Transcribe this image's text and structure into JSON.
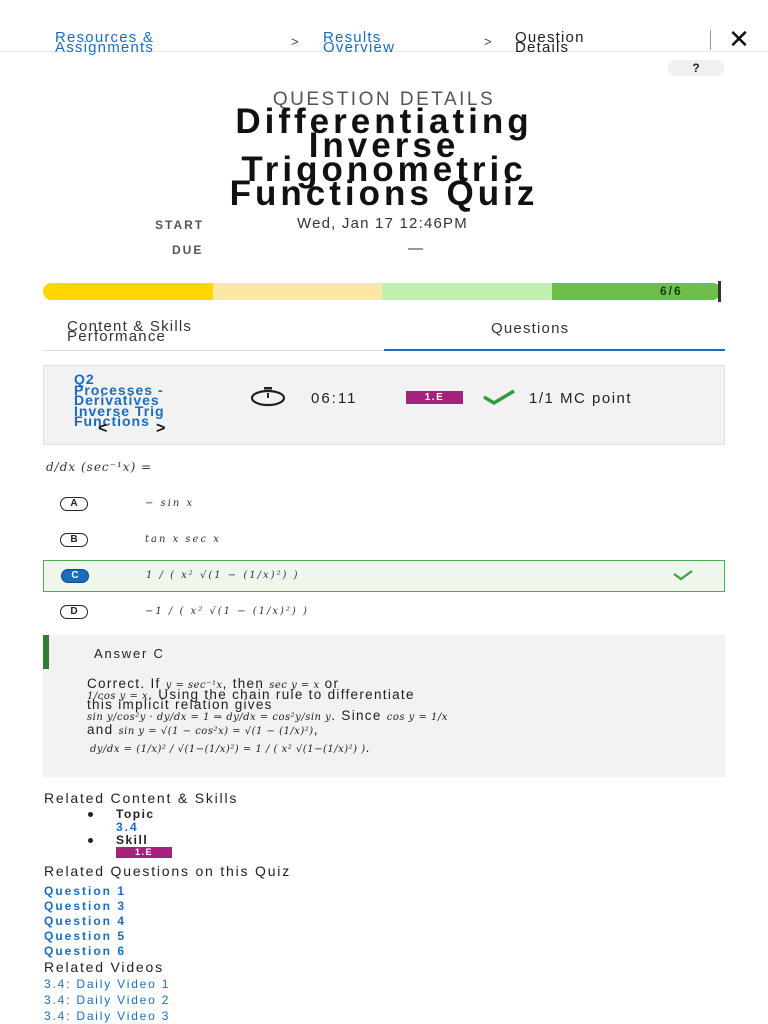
{
  "breadcrumb": {
    "item1_line1": "Resources &",
    "item1_line2": "Assignments",
    "item2_line1": "Results",
    "item2_line2": "Overview",
    "item3_line1": "Question",
    "item3_line2": "Details",
    "separator": ">"
  },
  "header": {
    "help_label": "?",
    "close_label": "✕",
    "eyebrow": "QUESTION DETAILS",
    "title_lines": [
      "Differentiating",
      "Inverse",
      "Trigonometric",
      "Functions Quiz"
    ],
    "start_label": "START",
    "start_value": "Wed, Jan 17 12:46PM",
    "due_label": "DUE",
    "due_value": "—"
  },
  "progress": {
    "label": "6/6",
    "segments": [
      "#ffd600",
      "#fbe9a3",
      "#c0f0ad",
      "#6cc04a"
    ]
  },
  "tabs": {
    "content_line1": "Content & Skills",
    "content_line2": "Performance",
    "questions": "Questions"
  },
  "question": {
    "link_lines": [
      "Q2",
      "Processes -",
      "Derivatives",
      "Inverse Trig",
      "Functions"
    ],
    "time": "06:11",
    "skill": "1.E",
    "score": "1/1 MC point",
    "prev": "<",
    "next": ">",
    "stem": "d/dx (sec⁻¹x) ="
  },
  "choices": [
    {
      "letter": "A",
      "text": "− sin x",
      "correct": false
    },
    {
      "letter": "B",
      "text": "tan x  sec x",
      "correct": false
    },
    {
      "letter": "C",
      "text": "1 / ( x² √(1 − (1/x)²) )",
      "correct": true
    },
    {
      "letter": "D",
      "text": "−1 / ( x² √(1 − (1/x)²) )",
      "correct": false
    }
  ],
  "answer": {
    "title": "Answer C",
    "line1a": "Correct. If ",
    "line1m1": "y = sec⁻¹x",
    "line1b": ", then ",
    "line1m2": "sec y = x",
    "line1c": " or",
    "line2m": "1/cos y = x",
    "line2b": ". Using the chain rule to differentiate",
    "line3": "this implicit relation gives",
    "line4m": "sin y/cos²y · dy/dx = 1 ⇒ dy/dx = cos²y/sin y",
    "line4b": ". Since ",
    "line4m2": "cos y = 1/x",
    "line5a": "and ",
    "line5m": "sin y = √(1 − cos²x) = √(1 − (1/x)²)",
    "line5b": ",",
    "line6m": "dy/dx = (1/x)² / √(1−(1/x)²) = 1 / ( x² √(1−(1/x)²) )",
    "line6b": "."
  },
  "related_content": {
    "heading": "Related Content & Skills",
    "topic_label": "Topic",
    "topic_value": "3.4",
    "skill_label": "Skill",
    "skill_value": "1.E"
  },
  "related_questions": {
    "heading": "Related Questions on this Quiz",
    "items": [
      "Question 1",
      "Question 3",
      "Question 4",
      "Question 5",
      "Question 6"
    ]
  },
  "related_videos": {
    "heading": "Related Videos",
    "items": [
      "3.4: Daily Video 1",
      "3.4: Daily Video 2",
      "3.4: Daily Video 3"
    ]
  }
}
